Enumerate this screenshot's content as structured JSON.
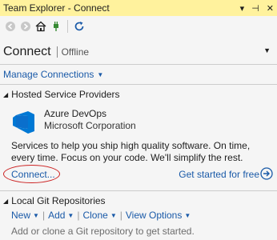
{
  "window": {
    "title": "Team Explorer - Connect",
    "controls": {
      "dropdown": "▾",
      "pin": "⊣",
      "close": "✕"
    }
  },
  "toolbar": {
    "icons": [
      "back-icon",
      "forward-icon",
      "home-icon",
      "plug-icon",
      "refresh-icon"
    ]
  },
  "header": {
    "title": "Connect",
    "status": "Offline"
  },
  "manage_connections": {
    "label": "Manage Connections"
  },
  "hosted_section": {
    "title": "Hosted Service Providers",
    "provider": {
      "name": "Azure DevOps",
      "company": "Microsoft Corporation",
      "description": "Services to help you ship high quality software. On time, every time. Focus on your code. We'll simplify the rest.",
      "connect_label": "Connect...",
      "get_started_label": "Get started for free"
    }
  },
  "git_section": {
    "title": "Local Git Repositories",
    "actions": {
      "new": "New",
      "add": "Add",
      "clone": "Clone",
      "view_options": "View Options"
    },
    "hint": "Add or clone a Git repository to get started."
  },
  "colors": {
    "titlebar": "#fff29d",
    "link": "#1a5aa8",
    "azure_blue": "#0078d4",
    "highlight_circle": "#cc2222"
  }
}
